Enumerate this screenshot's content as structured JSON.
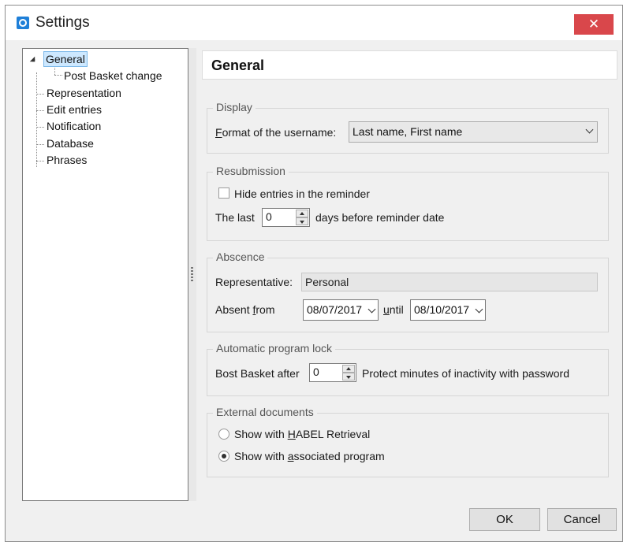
{
  "window": {
    "title": "Settings",
    "close_glyph": "✕"
  },
  "tree": {
    "items": [
      {
        "label": "General",
        "selected": true,
        "expanded": true
      },
      {
        "label": "Post Basket change",
        "child": true
      },
      {
        "label": "Representation"
      },
      {
        "label": "Edit entries"
      },
      {
        "label": "Notification"
      },
      {
        "label": "Database"
      },
      {
        "label": "Phrases"
      }
    ]
  },
  "page": {
    "title": "General"
  },
  "display": {
    "legend": "Display",
    "format_label_first": "F",
    "format_label_rest": "ormat of the username:",
    "format_value": "Last name, First name"
  },
  "resubmission": {
    "legend": "Resubmission",
    "hide_entries_label": "Hide entries in the reminder",
    "hide_entries_checked": false,
    "the_last_label": "The last",
    "days_value": "0",
    "days_suffix": "days before reminder date"
  },
  "absence": {
    "legend": "Abscence",
    "representative_label": "Representative:",
    "representative_value": "Personal",
    "absent_from_prefix": "Absent ",
    "absent_from_underlined": "f",
    "absent_from_suffix": "rom",
    "from_date": "08/07/2017",
    "until_underlined": "u",
    "until_rest": "ntil",
    "until_date": "08/10/2017"
  },
  "program_lock": {
    "legend": "Automatic program lock",
    "prefix_label": "Bost Basket after",
    "minutes_value": "0",
    "suffix_label": "Protect minutes of inactivity with password"
  },
  "external_documents": {
    "legend": "External documents",
    "option1_prefix": "Show with ",
    "option1_underlined": "H",
    "option1_suffix": "ABEL Retrieval",
    "option1_checked": false,
    "option2_prefix": "Show with ",
    "option2_underlined": "a",
    "option2_suffix": "ssociated program",
    "option2_checked": true
  },
  "buttons": {
    "ok": "OK",
    "cancel": "Cancel"
  },
  "colors": {
    "close_button": "#d9474b",
    "selection": "#cde8ff",
    "app_icon": "#1e7fd8"
  }
}
